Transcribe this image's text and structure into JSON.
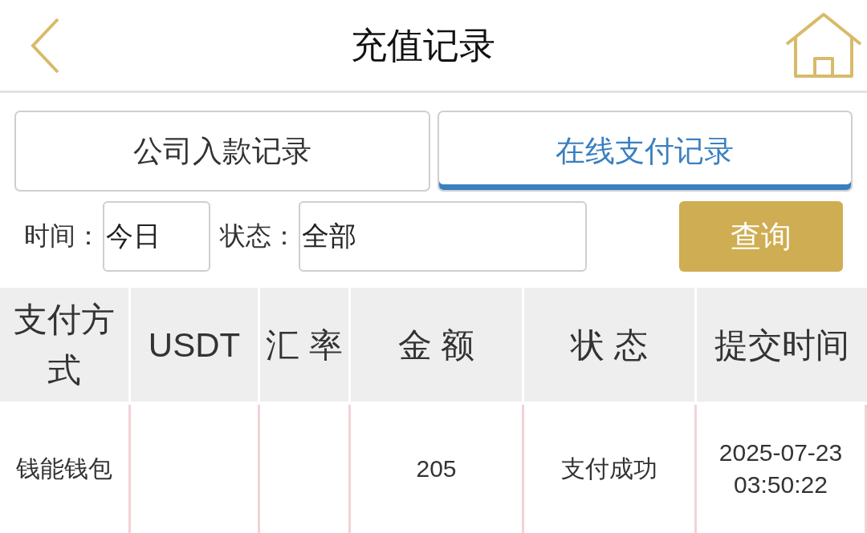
{
  "header": {
    "title": "充值记录"
  },
  "tabs": [
    {
      "label": "公司入款记录",
      "selected": false
    },
    {
      "label": "在线支付记录",
      "selected": true
    }
  ],
  "filters": [
    {
      "label": "时间：",
      "value": "今日"
    },
    {
      "label": "状态：",
      "value": "全部"
    }
  ],
  "query_button": "查询",
  "table": {
    "columns": [
      "支付方式",
      "USDT",
      "汇 率",
      "金 额",
      "状 态",
      "提交时间"
    ],
    "rows": [
      [
        "钱能钱包",
        "",
        "",
        "205",
        "支付成功",
        "2025-07-23 03:50:22"
      ]
    ]
  }
}
